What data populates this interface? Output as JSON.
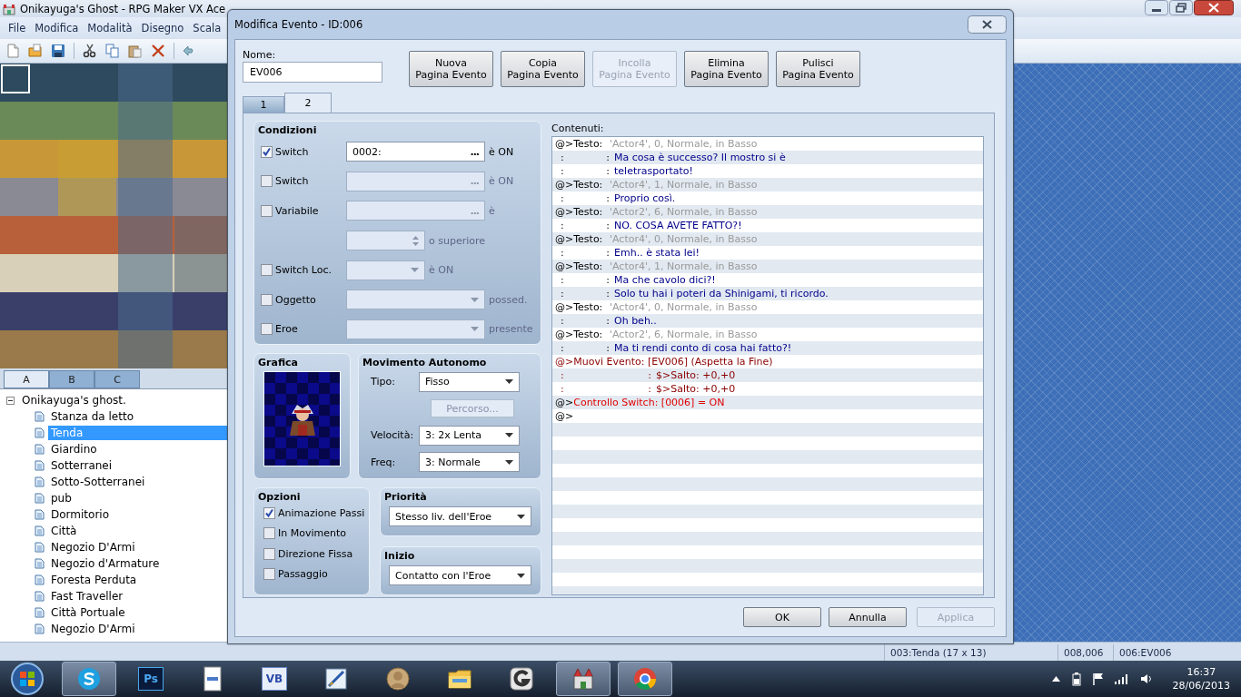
{
  "app": {
    "title": "Onikayuga's Ghost - RPG Maker VX Ace",
    "menu": [
      "File",
      "Modifica",
      "Modalità",
      "Disegno",
      "Scala"
    ]
  },
  "tileset_tabs": [
    {
      "label": "A",
      "selected": true
    },
    {
      "label": "B",
      "selected": false
    },
    {
      "label": "C",
      "selected": false
    }
  ],
  "map_tree": {
    "label": "Onikayuga's ghost.",
    "expanded": true,
    "children": [
      {
        "label": "Stanza da letto",
        "selected": false
      },
      {
        "label": "Tenda",
        "selected": true
      },
      {
        "label": "Giardino",
        "selected": false
      },
      {
        "label": "Sotterranei",
        "selected": false
      },
      {
        "label": "Sotto-Sotterranei",
        "selected": false
      },
      {
        "label": "pub",
        "selected": false
      },
      {
        "label": "Dormitorio",
        "selected": false
      },
      {
        "label": "Città",
        "selected": false
      },
      {
        "label": "Negozio D'Armi",
        "selected": false
      },
      {
        "label": "Negozio d'Armature",
        "selected": false
      },
      {
        "label": "Foresta Perduta",
        "selected": false
      },
      {
        "label": "Fast Traveller",
        "selected": false
      },
      {
        "label": "Città Portuale",
        "selected": false
      },
      {
        "label": "Negozio D'Armi",
        "selected": false
      }
    ]
  },
  "dialog": {
    "title": "Modifica Evento - ID:006",
    "name_label": "Nome:",
    "name_value": "EV006",
    "page_buttons": [
      {
        "lines": [
          "Nuova",
          "Pagina Evento"
        ],
        "disabled": false
      },
      {
        "lines": [
          "Copia",
          "Pagina Evento"
        ],
        "disabled": false
      },
      {
        "lines": [
          "Incolla",
          "Pagina Evento"
        ],
        "disabled": true
      },
      {
        "lines": [
          "Elimina",
          "Pagina Evento"
        ],
        "disabled": false
      },
      {
        "lines": [
          "Pulisci",
          "Pagina Evento"
        ],
        "disabled": false
      }
    ],
    "page_tabs": [
      {
        "label": "1",
        "selected": false
      },
      {
        "label": "2",
        "selected": true
      }
    ],
    "conditions": {
      "title": "Condizioni",
      "rows": [
        {
          "kind": "picker",
          "label": "Switch",
          "checked": true,
          "value": "0002:",
          "button_label": "...",
          "suffix": "è ON"
        },
        {
          "kind": "picker",
          "label": "Switch",
          "checked": false,
          "button_label": "...",
          "suffix": "è ON"
        },
        {
          "kind": "picker",
          "label": "Variabile",
          "checked": false,
          "button_label": "...",
          "suffix": "è"
        },
        {
          "kind": "spin",
          "disabled": true,
          "suffix": "o superiore"
        },
        {
          "kind": "short-dropdown",
          "label": "Switch Loc.",
          "checked": false,
          "suffix": "è ON"
        },
        {
          "kind": "dropdown",
          "label": "Oggetto",
          "checked": false,
          "suffix": "possed."
        },
        {
          "kind": "dropdown",
          "label": "Eroe",
          "checked": false,
          "suffix": "presente"
        }
      ]
    },
    "graphic": {
      "title": "Grafica"
    },
    "movement": {
      "title": "Movimento Autonomo",
      "rows": [
        {
          "kind": "select",
          "label": "Tipo:",
          "value": "Fisso"
        },
        {
          "kind": "button",
          "label": "Percorso...",
          "disabled": true
        },
        {
          "kind": "select",
          "label": "Velocità:",
          "value": "3: 2x Lenta"
        },
        {
          "kind": "select",
          "label": "Freq:",
          "value": "3: Normale"
        }
      ]
    },
    "options": {
      "title": "Opzioni",
      "items": [
        {
          "label": "Animazione Passi",
          "checked": true
        },
        {
          "label": "In Movimento",
          "checked": false
        },
        {
          "label": "Direzione Fissa",
          "checked": false
        },
        {
          "label": "Passaggio",
          "checked": false
        }
      ]
    },
    "priority": {
      "title": "Priorità",
      "value": "Stesso liv. dell'Eroe"
    },
    "trigger": {
      "title": "Inizio",
      "value": "Contatto con l'Eroe"
    },
    "contents": {
      "label": "Contenuti:",
      "lines": [
        {
          "kind": "command",
          "head": "@>Testo:",
          "text": "'Actor4', 0, Normale, in Basso"
        },
        {
          "kind": "message",
          "lead": ":",
          "sep": ":",
          "text": "Ma cosa è successo? Il mostro si è"
        },
        {
          "kind": "message",
          "lead": ":",
          "sep": ":",
          "text": "teletrasportato!"
        },
        {
          "kind": "command",
          "head": "@>Testo:",
          "text": "'Actor4', 1, Normale, in Basso"
        },
        {
          "kind": "message",
          "lead": ":",
          "sep": ":",
          "text": "Proprio così."
        },
        {
          "kind": "command",
          "head": "@>Testo:",
          "text": "'Actor2', 6, Normale, in Basso"
        },
        {
          "kind": "message",
          "lead": ":",
          "sep": ":",
          "text": "NO. COSA AVETE FATTO?!"
        },
        {
          "kind": "command",
          "head": "@>Testo:",
          "text": "'Actor4', 0, Normale, in Basso"
        },
        {
          "kind": "message",
          "lead": ":",
          "sep": ":",
          "text": "Emh.. è stata lei!"
        },
        {
          "kind": "command",
          "head": "@>Testo:",
          "text": "'Actor4', 1, Normale, in Basso"
        },
        {
          "kind": "message",
          "lead": ":",
          "sep": ":",
          "text": "Ma che cavolo dici?!"
        },
        {
          "kind": "message",
          "lead": ":",
          "sep": ":",
          "text": "Solo tu hai i poteri da Shinigami, ti ricordo."
        },
        {
          "kind": "command",
          "head": "@>Testo:",
          "text": "'Actor4', 0, Normale, in Basso"
        },
        {
          "kind": "message",
          "lead": ":",
          "sep": ":",
          "text": "Oh beh.."
        },
        {
          "kind": "command",
          "head": "@>Testo:",
          "text": "'Actor2', 6, Normale, in Basso"
        },
        {
          "kind": "message",
          "lead": ":",
          "sep": ":",
          "text": "Ma ti rendi conto di cosa hai fatto?!"
        },
        {
          "kind": "move",
          "head": "@>",
          "text": "Muovi Evento: [EV006] (Aspetta la Fine)"
        },
        {
          "kind": "move-step",
          "lead": ":",
          "sep": ":",
          "text": "$>Salto: +0,+0"
        },
        {
          "kind": "move-step",
          "lead": ":",
          "sep": ":",
          "text": "$>Salto: +0,+0"
        },
        {
          "kind": "switch",
          "head": "@>",
          "text": "Controllo Switch: [0006] = ON"
        },
        {
          "kind": "empty",
          "head": "@>"
        }
      ]
    },
    "buttons": [
      {
        "label": "OK",
        "disabled": false
      },
      {
        "label": "Annulla",
        "disabled": false
      },
      {
        "label": "Applica",
        "disabled": true
      }
    ]
  },
  "status_bar": [
    "003:Tenda (17 x 13)",
    "008,006",
    "006:EV006"
  ],
  "taskbar": {
    "apps": [
      {
        "kind": "skype",
        "active": true
      },
      {
        "kind": "photoshop",
        "glyph": "Ps",
        "active": false
      },
      {
        "kind": "document",
        "active": false
      },
      {
        "kind": "vb",
        "glyph": "VB",
        "active": false
      },
      {
        "kind": "pen",
        "active": false
      },
      {
        "kind": "portrait",
        "active": false
      },
      {
        "kind": "folder",
        "active": false
      },
      {
        "kind": "g-app",
        "active": false
      },
      {
        "kind": "castle",
        "active": true
      },
      {
        "kind": "chrome",
        "active": true
      }
    ],
    "time": "16:37",
    "date": "28/06/2013"
  }
}
